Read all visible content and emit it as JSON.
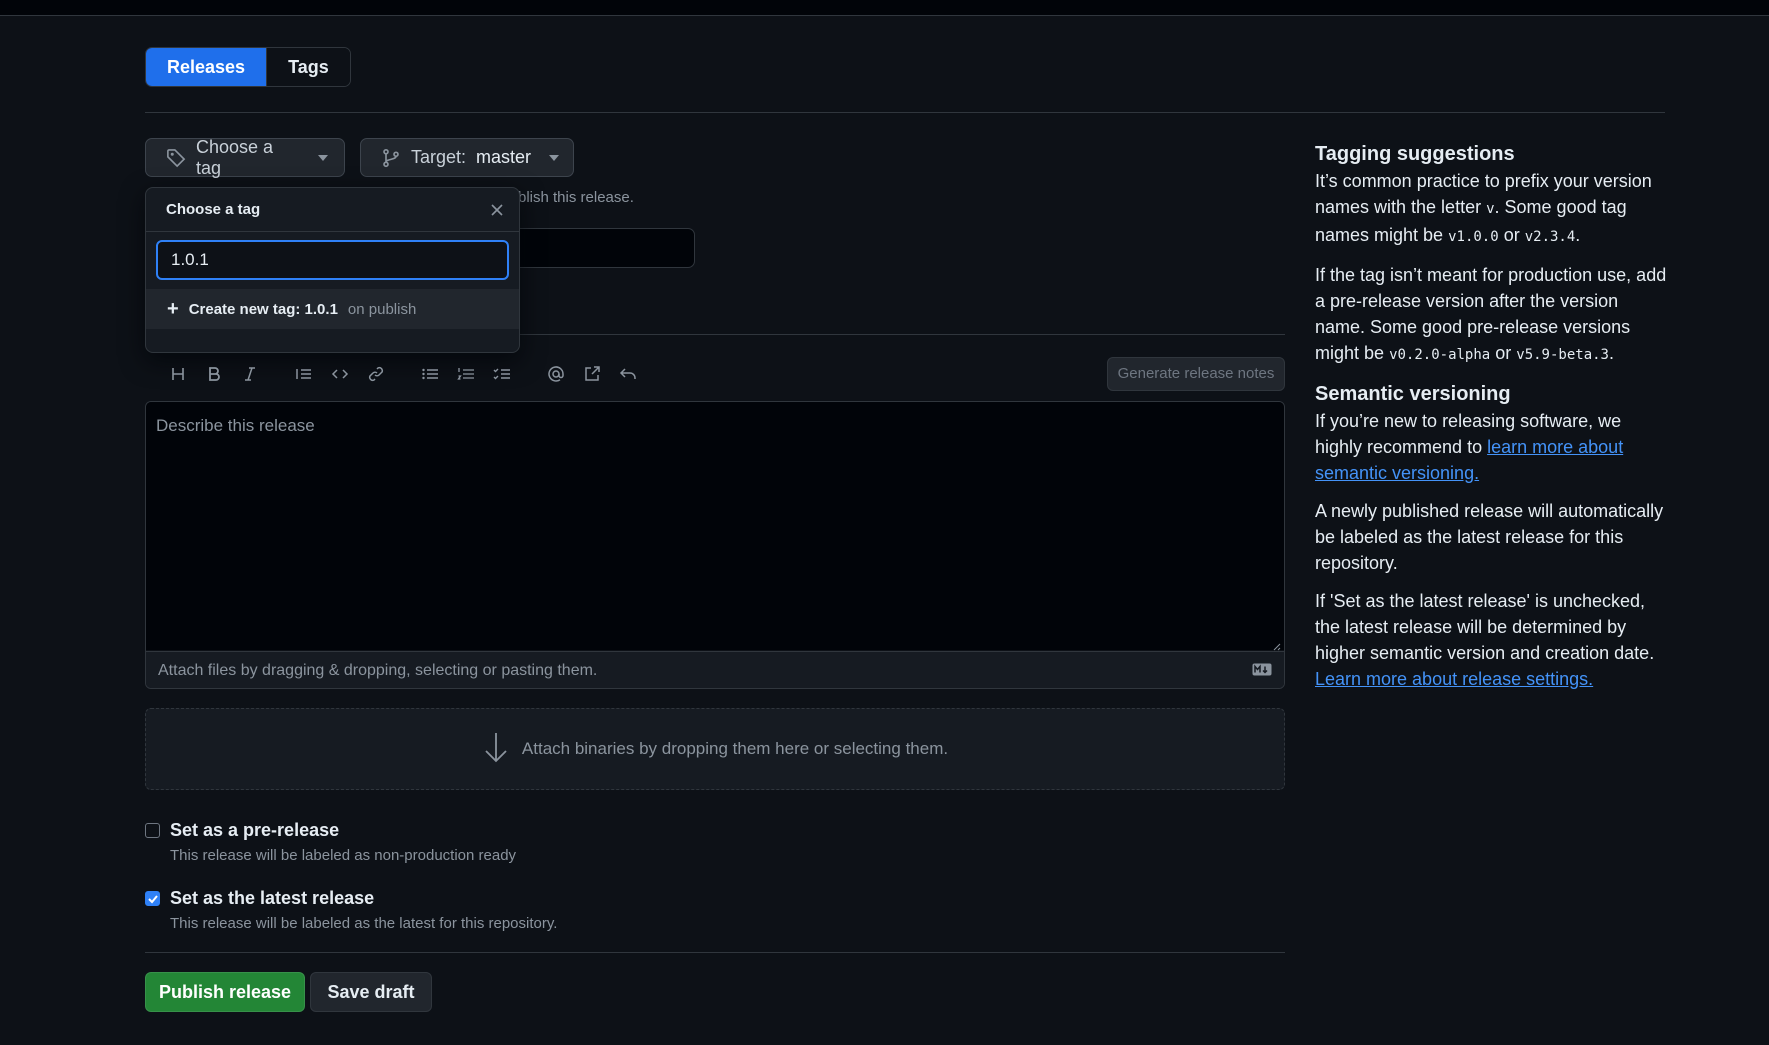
{
  "tabs": [
    {
      "label": "Releases",
      "active": true
    },
    {
      "label": "Tags",
      "active": false
    }
  ],
  "tag_button": {
    "label": "Choose a tag"
  },
  "target_button": {
    "prefix": "Target:",
    "branch": "master"
  },
  "tag_hint": "blish this release.",
  "popover": {
    "title": "Choose a tag",
    "input_value": "1.0.1",
    "create_prefix": "Create new tag: 1.0.1",
    "create_suffix": "on publish"
  },
  "toolbar": {
    "icons": [
      "heading-icon",
      "bold-icon",
      "italic-icon",
      "quote-icon",
      "code-icon",
      "link-icon",
      "unordered-list-icon",
      "ordered-list-icon",
      "task-list-icon",
      "mention-icon",
      "reference-icon",
      "undo-icon"
    ],
    "generate_label": "Generate release notes"
  },
  "editor": {
    "placeholder": "Describe this release",
    "attach_text": "Attach files by dragging & dropping, selecting or pasting them."
  },
  "dropzone": {
    "text": "Attach binaries by dropping them here or selecting them."
  },
  "prerelease": {
    "label": "Set as a pre-release",
    "desc": "This release will be labeled as non-production ready",
    "checked": false
  },
  "latest": {
    "label": "Set as the latest release",
    "desc": "This release will be labeled as the latest for this repository.",
    "checked": true
  },
  "actions": {
    "publish": "Publish release",
    "draft": "Save draft"
  },
  "sidebar": {
    "tag_title": "Tagging suggestions",
    "tag_p1_a": "It’s common practice to prefix your version names with the letter",
    "tag_p1_code_v": "v",
    "tag_p1_b": ". Some good tag names might be",
    "tag_p1_code1": "v1.0.0",
    "tag_p1_or": "or",
    "tag_p1_code2": "v2.3.4",
    "tag_p1_end": ".",
    "tag_p2_a": "If the tag isn’t meant for production use, add a pre-release version after the version name. Some good pre-release versions might be",
    "tag_p2_code1": "v0.2.0-alpha",
    "tag_p2_or": "or",
    "tag_p2_code2": "v5.9-beta.3",
    "tag_p2_end": ".",
    "sem_title": "Semantic versioning",
    "sem_p1": "If you’re new to releasing software, we highly recommend to",
    "sem_link": "learn more about semantic versioning.",
    "sem_p2": "A newly published release will automatically be labeled as the latest release for this repository.",
    "sem_p3": "If 'Set as the latest release' is unchecked, the latest release will be determined by higher semantic version and creation date.",
    "sem_link2": "Learn more about release settings."
  },
  "colors": {
    "accent": "#1f6feb",
    "primary": "#238636",
    "link": "#4493f8",
    "background": "#0d1117"
  }
}
